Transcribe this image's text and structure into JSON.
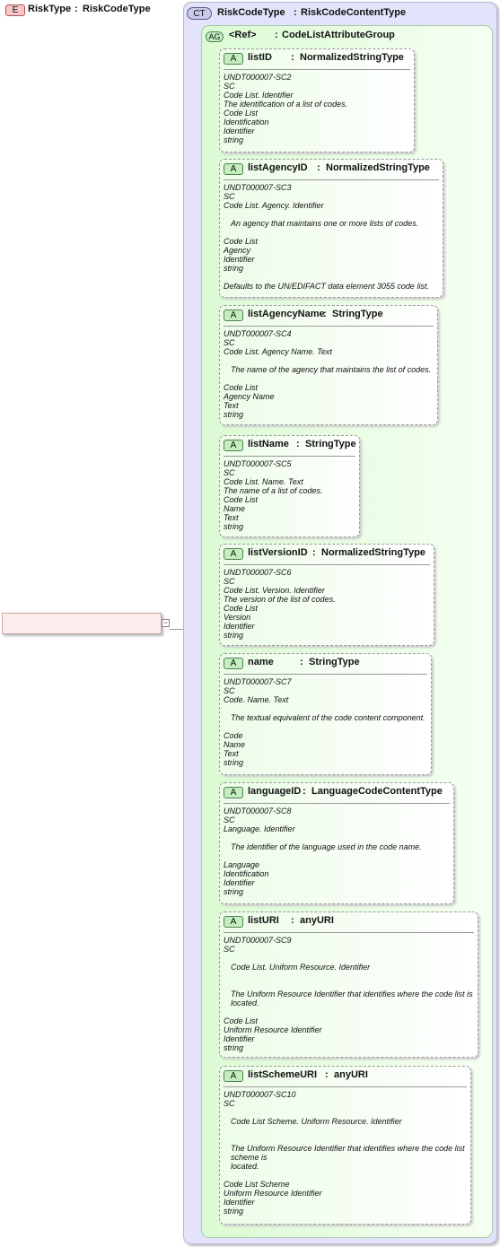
{
  "element": {
    "badge": "E",
    "name": "RiskType",
    "separator": ":",
    "type": "RiskCodeType",
    "collapse_symbol": "−"
  },
  "complex_type": {
    "badge": "CT",
    "name": "RiskCodeType",
    "separator": ":",
    "type": "RiskCodeContentType"
  },
  "attribute_group": {
    "badge": "AG",
    "name": "<Ref>",
    "separator": ":",
    "type": "CodeListAttributeGroup"
  },
  "attributes": [
    {
      "badge": "A",
      "name": "listID",
      "separator": ":",
      "type": "NormalizedStringType",
      "doc": [
        "UNDT000007-SC2",
        "SC",
        "Code List. Identifier",
        "The identification of a list of codes.",
        "Code List",
        "Identification",
        "Identifier",
        "string"
      ]
    },
    {
      "badge": "A",
      "name": "listAgencyID",
      "separator": ":",
      "type": "NormalizedStringType",
      "doc": [
        "UNDT000007-SC3",
        "SC",
        "Code List. Agency. Identifier",
        "",
        "An agency that maintains one or more lists of codes.",
        "",
        "Code List",
        "Agency",
        "Identifier",
        "string",
        "",
        "Defaults to the UN/EDIFACT data element 3055 code list."
      ]
    },
    {
      "badge": "A",
      "name": "listAgencyName",
      "separator": ":",
      "type": "StringType",
      "doc": [
        "UNDT000007-SC4",
        "SC",
        "Code List. Agency Name. Text",
        "",
        "The name of the agency that maintains the list of codes.",
        "",
        "Code List",
        "Agency Name",
        "Text",
        "string"
      ]
    },
    {
      "badge": "A",
      "name": "listName",
      "separator": ":",
      "type": "StringType",
      "doc": [
        "UNDT000007-SC5",
        "SC",
        "Code List. Name. Text",
        "The name of a list of codes.",
        "Code List",
        "Name",
        "Text",
        "string"
      ]
    },
    {
      "badge": "A",
      "name": "listVersionID",
      "separator": ":",
      "type": "NormalizedStringType",
      "doc": [
        "UNDT000007-SC6",
        "SC",
        "Code List. Version. Identifier",
        "The version of the list of codes.",
        "Code List",
        "Version",
        "Identifier",
        "string"
      ]
    },
    {
      "badge": "A",
      "name": "name",
      "separator": ":",
      "type": "StringType",
      "doc": [
        "UNDT000007-SC7",
        "SC",
        "Code. Name. Text",
        "",
        "The textual equivalent of the code content component.",
        "",
        "Code",
        "Name",
        "Text",
        "string"
      ]
    },
    {
      "badge": "A",
      "name": "languageID",
      "separator": ":",
      "type": "LanguageCodeContentType",
      "doc": [
        "UNDT000007-SC8",
        "SC",
        "Language. Identifier",
        "",
        "The identifier of the language used in the code name.",
        "",
        "Language",
        "Identification",
        "Identifier",
        "string"
      ]
    },
    {
      "badge": "A",
      "name": "listURI",
      "separator": ":",
      "type": "anyURI",
      "doc": [
        "UNDT000007-SC9",
        "SC",
        "",
        "Code List. Uniform Resource. Identifier",
        "",
        "",
        "The Uniform Resource Identifier that identifies where the code list is located.",
        "",
        "Code List",
        "Uniform Resource Identifier",
        "Identifier",
        "string"
      ]
    },
    {
      "badge": "A",
      "name": "listSchemeURI",
      "separator": ":",
      "type": "anyURI",
      "doc": [
        "UNDT000007-SC10",
        "SC",
        "",
        "Code List Scheme. Uniform Resource. Identifier",
        "",
        "",
        "The Uniform Resource Identifier that identifies where the code list scheme is",
        "located.",
        "",
        "Code List Scheme",
        "Uniform Resource Identifier",
        "Identifier",
        "string"
      ]
    }
  ]
}
